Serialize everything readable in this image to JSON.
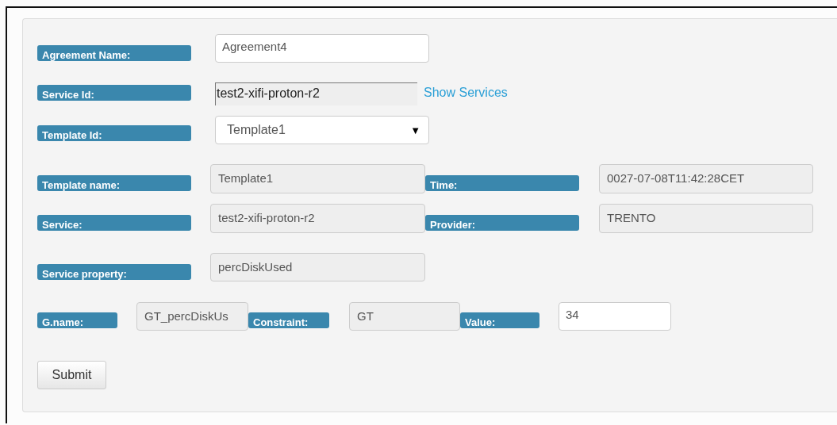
{
  "rows": [
    {
      "fields": [
        {
          "label": "Agreement Name:",
          "kind": "input",
          "value": "Agreement4"
        }
      ]
    },
    {
      "fields": [
        {
          "label": "Service Id:",
          "kind": "id",
          "value": "test2-xifi-proton-r2",
          "link": "Show Services"
        }
      ]
    },
    {
      "fields": [
        {
          "label": "Template Id:",
          "kind": "select",
          "value": "Template1",
          "caret": "▼"
        }
      ]
    },
    {
      "fields": [
        {
          "label": "Template name:",
          "kind": "readonly",
          "value": "Template1"
        },
        {
          "label": "Time:",
          "kind": "readonly",
          "value": "0027-07-08T11:42:28CET"
        }
      ]
    },
    {
      "fields": [
        {
          "label": "Service:",
          "kind": "readonly",
          "value": "test2-xifi-proton-r2"
        },
        {
          "label": "Provider:",
          "kind": "readonly",
          "value": "TRENTO"
        }
      ]
    },
    {
      "fields": [
        {
          "label": "Service property:",
          "kind": "readonly",
          "value": "percDiskUsed"
        }
      ]
    },
    {
      "fields": [
        {
          "label": "G.name:",
          "kind": "readonly",
          "value": "GT_percDiskUs"
        },
        {
          "label": "Constraint:",
          "kind": "readonly",
          "value": "GT"
        },
        {
          "label": "Value:",
          "kind": "input",
          "value": "34"
        }
      ]
    }
  ],
  "submit": "Submit"
}
